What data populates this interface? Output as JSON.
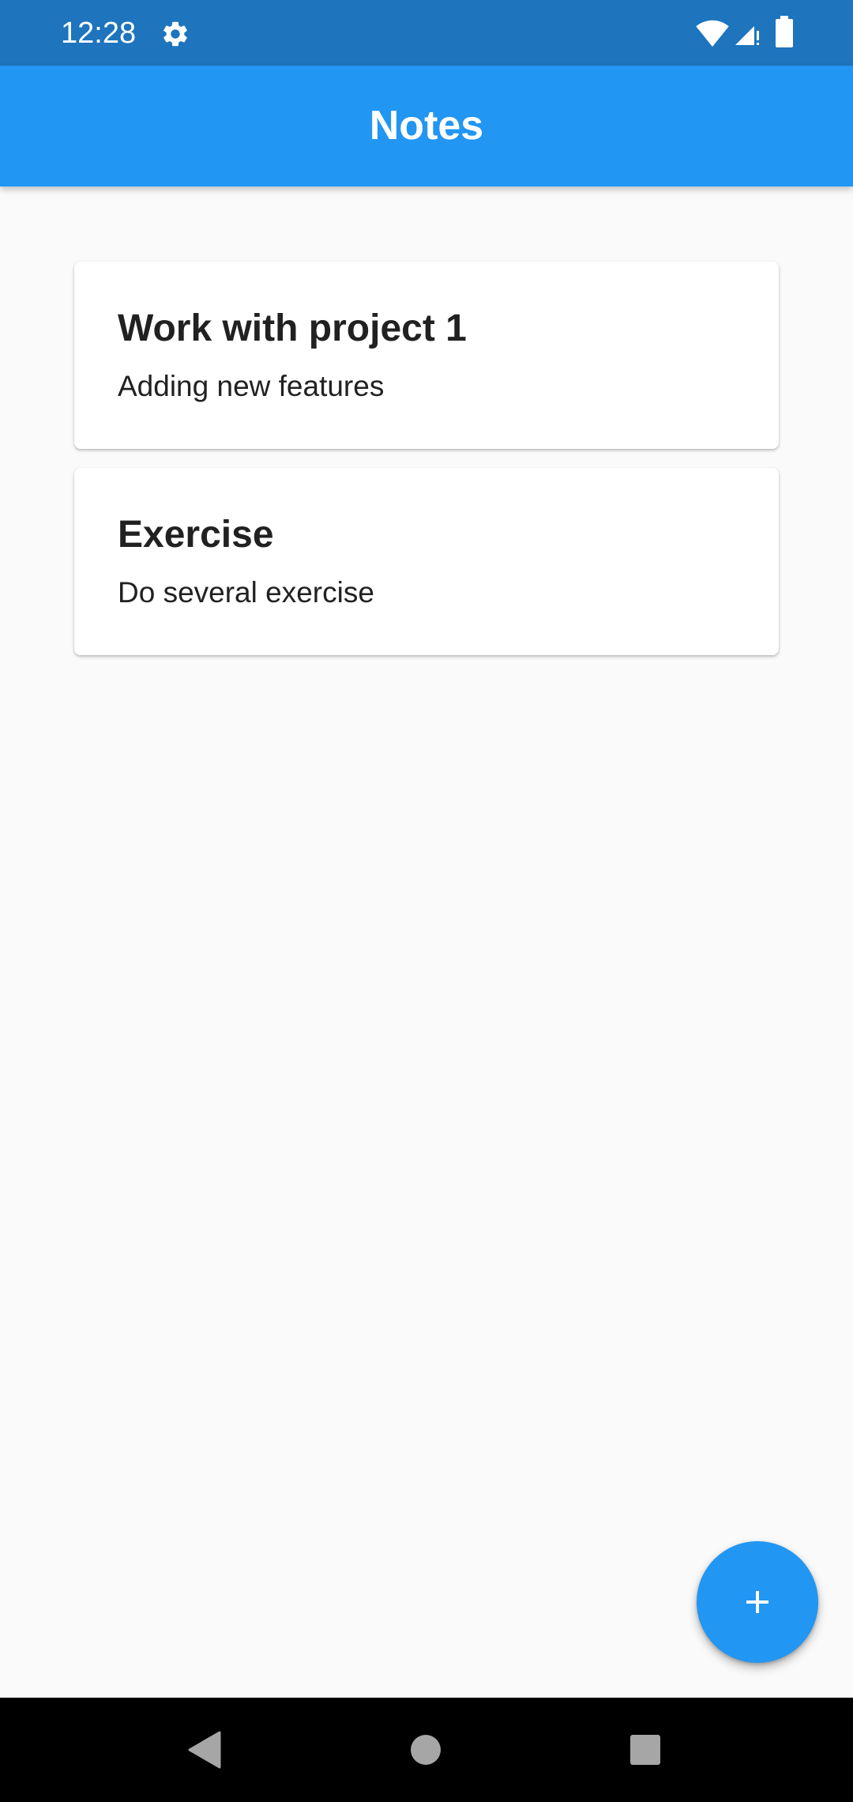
{
  "status_bar": {
    "time": "12:28",
    "icons": [
      "gear-icon",
      "wifi-icon",
      "signal-icon",
      "battery-icon"
    ]
  },
  "app_bar": {
    "title": "Notes"
  },
  "notes": [
    {
      "title": "Work with project 1",
      "description": "Adding new features"
    },
    {
      "title": "Exercise",
      "description": "Do several exercise"
    }
  ],
  "fab": {
    "icon": "plus-icon"
  },
  "nav_bar": {
    "icons": [
      "back-icon",
      "home-icon",
      "recents-icon"
    ]
  },
  "colors": {
    "status_bar": "#1e74bd",
    "primary": "#2196f3",
    "background": "#fafafa",
    "card": "#ffffff",
    "text": "#212121",
    "nav_bar": "#000000"
  }
}
